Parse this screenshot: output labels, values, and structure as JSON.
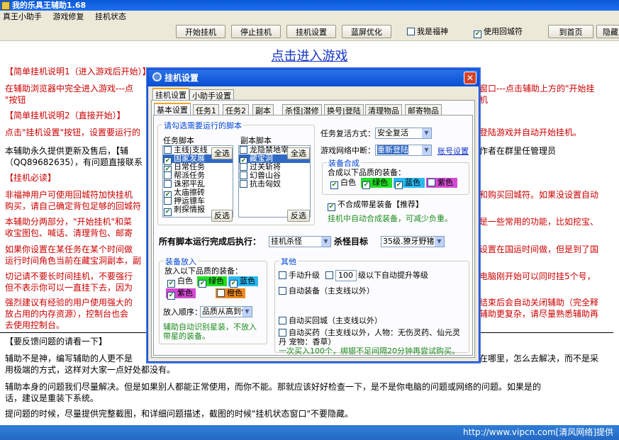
{
  "window": {
    "title": "我的乐具王辅助1.68"
  },
  "menu": [
    "真王小助手",
    "游戏修复",
    "挂机状态"
  ],
  "toolbar": {
    "start_button": "开始挂机",
    "stop_button": "停止挂机",
    "settings_button": "挂机设置",
    "bluescreen_button": "蓝屏优化",
    "fushen_label": "我是福神",
    "fushen_checked": false,
    "recall_label": "使用回城符",
    "recall_checked": true,
    "top_button": "到首页",
    "hide_button": "隐藏"
  },
  "main": {
    "link": "点击进入游戏",
    "lines": [
      {
        "text": "【简单挂机说明1（进入游戏后开始）】",
        "color": "red"
      },
      {
        "text": "在辅助浏览器中完全进入游戏---点",
        "color": "red"
      },
      {
        "text": "\"按钮",
        "color": "red"
      },
      {
        "text": "【简单挂机说明2（直接开始）】",
        "color": "red"
      },
      {
        "text": "点击\"挂机设置\"按钮，设置要运行的",
        "color": "red"
      },
      {
        "text": "本辅助永久提供更新及售后，【辅",
        "color": "black"
      },
      {
        "text": "（QQ89682635），有问题直接联系",
        "color": "black"
      },
      {
        "text": "【挂机必读】",
        "color": "red"
      },
      {
        "text": "非福神用户可使用回城符加快挂机",
        "color": "red"
      },
      {
        "text": "购买，请自己确定背包足够的回城符",
        "color": "red"
      },
      {
        "text": "本辅助分两部分，\"开始挂机\"和菜",
        "color": "red"
      },
      {
        "text": "收宝图包、喊话、清理背包、邮寄",
        "color": "red"
      },
      {
        "text": "如果你设置在某任务在某个时间做",
        "color": "red"
      },
      {
        "text": "运行时间角色当前在藏宝洞副本，副",
        "color": "red"
      },
      {
        "text": "切记请不要长时间挂机，不要强行",
        "color": "red"
      },
      {
        "text": "但不表示你可以一直挂下去，因为",
        "color": "red"
      },
      {
        "text": "强烈建议有经验的用户使用强大的",
        "color": "red"
      },
      {
        "text": "放占用的内存资源），控制台也会",
        "color": "red"
      },
      {
        "text": "去使用控制台。",
        "color": "red"
      }
    ],
    "right_fragments": [
      {
        "text": "窗口---点击辅助上方的\"开始挂",
        "color": "red"
      },
      {
        "text": "机",
        "color": "red"
      },
      {
        "text": "登陆游戏并自动开始挂机。",
        "color": "red"
      },
      {
        "text": "作者在群里任管理员",
        "color": "black"
      },
      {
        "text": "和购买回城符。如果没设置自动",
        "color": "red"
      },
      {
        "text": "是一些常用的功能，比如挖宝、",
        "color": "red"
      },
      {
        "text": "设置在国运时间做，但是到了国",
        "color": "red"
      },
      {
        "text": "电脑刚开始可以同时挂5个号，",
        "color": "red"
      },
      {
        "text": "结束后会自动关闭辅助（完全释",
        "color": "red"
      },
      {
        "text": "辅助更复杂，请尽量熟悉辅助再",
        "color": "red"
      },
      {
        "text": "在哪里，怎么去解决，而不是采",
        "color": "black"
      }
    ],
    "feedback_title": "【要反馈问题的请看一下】",
    "feedback_lines": [
      "辅助不是神，编写辅助的人更不是",
      "用极端的方式，这样对大家一点好处都没有。",
      "辅助本身的问题我们尽量解决。但是如果别人都能正常使用，而你不能。那就应该好好检查一下，是不是你电脑的问题或网络的问题。如果是的",
      "话，建议是重装下系统。",
      "提问题的时候，尽量提供完整截图，和详细问题描述，截图的时候\"挂机状态窗口\"不要隐藏。"
    ]
  },
  "statusbar": {
    "text": "http://www.vipcn.com[清风网络]提供"
  },
  "dialog": {
    "title": "挂机设置",
    "close": "✕",
    "top_tabs": [
      "挂机设置",
      "小助手设置"
    ],
    "sub_tabs": [
      "基本设置",
      "任务1",
      "任务2",
      "副本",
      "杀怪|潜修",
      "换号|登陆",
      "清理物品",
      "邮寄物品"
    ],
    "scripts_group": "请勾选需要运行的脚本",
    "task_header": "任务脚本",
    "task_select_all": "全选",
    "task_invert": "反选",
    "task_items": [
      {
        "label": "主线|支线",
        "checked": false,
        "selected": false
      },
      {
        "label": "国家发展",
        "checked": true,
        "selected": true
      },
      {
        "label": "日常任务",
        "checked": true,
        "selected": false
      },
      {
        "label": "帮派任务",
        "checked": false,
        "selected": false
      },
      {
        "label": "诛邪平乱",
        "checked": false,
        "selected": false
      },
      {
        "label": "太庙擦砖",
        "checked": true,
        "selected": false
      },
      {
        "label": "押运镖车",
        "checked": false,
        "selected": false
      },
      {
        "label": "刺探情报",
        "checked": true,
        "selected": false
      }
    ],
    "dungeon_header": "副本脚本",
    "dungeon_select_all": "全选",
    "dungeon_invert": "反选",
    "dungeon_items": [
      {
        "label": "龙隐禁地宰",
        "checked": false,
        "selected": false
      },
      {
        "label": "藏宝洞",
        "checked": true,
        "selected": true
      },
      {
        "label": "过关斩将",
        "checked": false,
        "selected": false
      },
      {
        "label": "幻兽山谷",
        "checked": false,
        "selected": false
      },
      {
        "label": "抗击匈奴",
        "checked": false,
        "selected": false
      }
    ],
    "revive_label": "任务复活方式：",
    "revive_value": "安全复活",
    "network_label": "游戏网络中断：",
    "network_value": "重新登陆",
    "account_link": "账号设置",
    "equip_group": "装备合成",
    "equip_text": "合成以下品质的装备：",
    "equip_colors": [
      {
        "label": "白色",
        "checked": true,
        "bg": "#ffffff"
      },
      {
        "label": "绿色",
        "checked": true,
        "bg": "#22dd22"
      },
      {
        "label": "蓝色",
        "checked": true,
        "bg": "#2ab8f0"
      },
      {
        "label": "紫色",
        "checked": false,
        "bg": "#d24ad2"
      }
    ],
    "equip_nomerge": "不合成带星装备【推荐】",
    "equip_nomerge_checked": true,
    "equip_hint": "挂机中自动合成装备，可减少负重。",
    "after_all_label": "所有脚本运行完成后执行：",
    "after_all_value": "挂机杀怪",
    "kill_target_label": "杀怪目标",
    "kill_target_value": "35级.獠牙野猪",
    "gear_group": "装备放入",
    "gear_text": "放入以下品质的装备：",
    "gear_colors": [
      {
        "label": "白色",
        "checked": true,
        "bg": "#ffffff"
      },
      {
        "label": "绿色",
        "checked": true,
        "bg": "#22dd22"
      },
      {
        "label": "蓝色",
        "checked": true,
        "bg": "#2ab8f0"
      },
      {
        "label": "紫色",
        "checked": true,
        "bg": "#d24ad2"
      },
      {
        "label": "橙色",
        "checked": false,
        "bg": "#f08a20"
      }
    ],
    "gear_order_label": "放入顺序：",
    "gear_order_value": "品质从高到低",
    "gear_hint": "辅助自动识别星装，不放入带星的装备。",
    "other_group": "其他",
    "manual_upgrade": "手动升级",
    "level_value": "100",
    "level_suffix": "级以下自动提升等级",
    "auto_equip": "自动装备（主支线以外）",
    "auto_buy_city": "自动买回城（主支线以外）",
    "auto_buy_potion": "自动买药（主支线以外，人物：无伤灵药、仙元灵丹 宠物：香草）",
    "buy_hint": "一次买入100个，绑银不足间隔20分钟再尝试购买。"
  }
}
